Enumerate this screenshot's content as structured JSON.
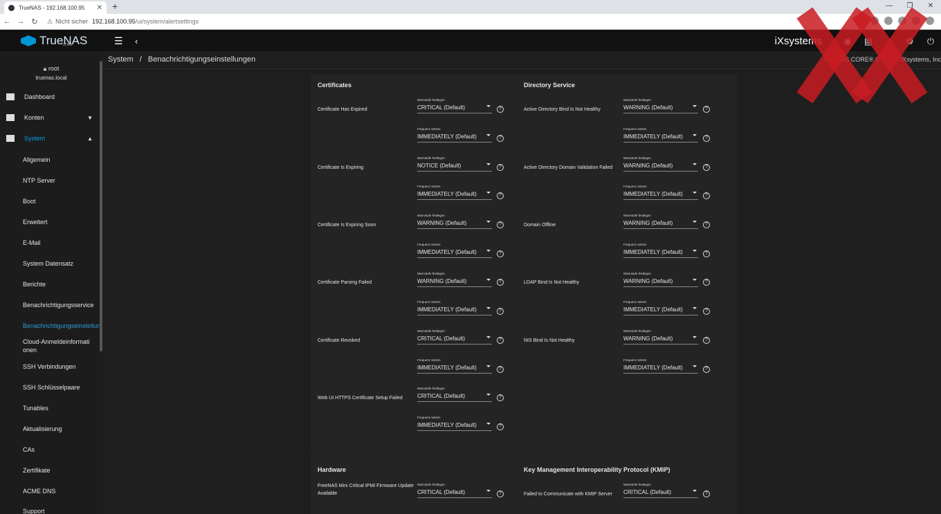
{
  "browser": {
    "tab_title": "TrueNAS - 192.168.100.95",
    "new_tab": "+",
    "security": "Nicht sicher",
    "url_host": "192.168.100.95",
    "url_path": "/ui/system/alertsettings"
  },
  "topbar": {
    "brand": "TrueNAS",
    "brand_sub": "CORE",
    "vendor": "iXsystems"
  },
  "breadcrumb": {
    "root": "System",
    "sep": "/",
    "current": "Benachrichtigungseinstellungen"
  },
  "copyright": "TrueNAS CORE® © 2020 - iXsystems, Inc",
  "sidebar": {
    "user": "root",
    "host": "truenas.local",
    "items": [
      {
        "label": "Dashboard"
      },
      {
        "label": "Konten"
      },
      {
        "label": "System"
      }
    ],
    "subitems": [
      {
        "label": "Allgemein"
      },
      {
        "label": "NTP Server"
      },
      {
        "label": "Boot"
      },
      {
        "label": "Erweitert"
      },
      {
        "label": "E-Mail"
      },
      {
        "label": "System Datensatz"
      },
      {
        "label": "Berichte"
      },
      {
        "label": "Benachrichtigungsservice"
      },
      {
        "label": "Benachrichtigungseinstellungen"
      },
      {
        "label": "Cloud-Anmeldeinformationen"
      },
      {
        "label": "SSH Verbindungen"
      },
      {
        "label": "SSH Schlüsselpaare"
      },
      {
        "label": "Tunables"
      },
      {
        "label": "Aktualisierung"
      },
      {
        "label": "CAs"
      },
      {
        "label": "Zertifikate"
      },
      {
        "label": "ACME DNS"
      },
      {
        "label": "Support"
      }
    ]
  },
  "labels": {
    "level": "Warnstufe festlegen",
    "freq": "Frequenz setzen",
    "help": "?"
  },
  "sections": {
    "certificates": {
      "title": "Certificates",
      "alerts": [
        {
          "name": "Certificate Has Expired",
          "level": "CRITICAL (Default)",
          "freq": "IMMEDIATELY (Default)"
        },
        {
          "name": "Certificate Is Expiring",
          "level": "NOTICE (Default)",
          "freq": "IMMEDIATELY (Default)"
        },
        {
          "name": "Certificate Is Expiring Soon",
          "level": "WARNING (Default)",
          "freq": "IMMEDIATELY (Default)"
        },
        {
          "name": "Certificate Parsing Failed",
          "level": "WARNING (Default)",
          "freq": "IMMEDIATELY (Default)"
        },
        {
          "name": "Certificate Revoked",
          "level": "CRITICAL (Default)",
          "freq": "IMMEDIATELY (Default)"
        },
        {
          "name": "Web UI HTTPS Certificate Setup Failed",
          "level": "CRITICAL (Default)",
          "freq": "IMMEDIATELY (Default)"
        }
      ]
    },
    "directory": {
      "title": "Directory Service",
      "alerts": [
        {
          "name": "Active Directory Bind Is Not Healthy",
          "level": "WARNING (Default)",
          "freq": "IMMEDIATELY (Default)"
        },
        {
          "name": "Active Directory Domain Validation Failed",
          "level": "WARNING (Default)",
          "freq": "IMMEDIATELY (Default)"
        },
        {
          "name": "Domain Offline",
          "level": "WARNING (Default)",
          "freq": "IMMEDIATELY (Default)"
        },
        {
          "name": "LDAP Bind Is Not Healthy",
          "level": "WARNING (Default)",
          "freq": "IMMEDIATELY (Default)"
        },
        {
          "name": "NIS Bind Is Not Healthy",
          "level": "WARNING (Default)",
          "freq": "IMMEDIATELY (Default)"
        }
      ]
    },
    "hardware": {
      "title": "Hardware",
      "alerts": [
        {
          "name": "FreeNAS Mini Critical IPMI Firmware Update Available",
          "level": "CRITICAL (Default)"
        }
      ]
    },
    "kmip": {
      "title": "Key Management Interoperability Protocol (KMIP)",
      "alerts": [
        {
          "name": "Failed to Communicate with KMIP Server",
          "level": "CRITICAL (Default)"
        }
      ]
    }
  }
}
